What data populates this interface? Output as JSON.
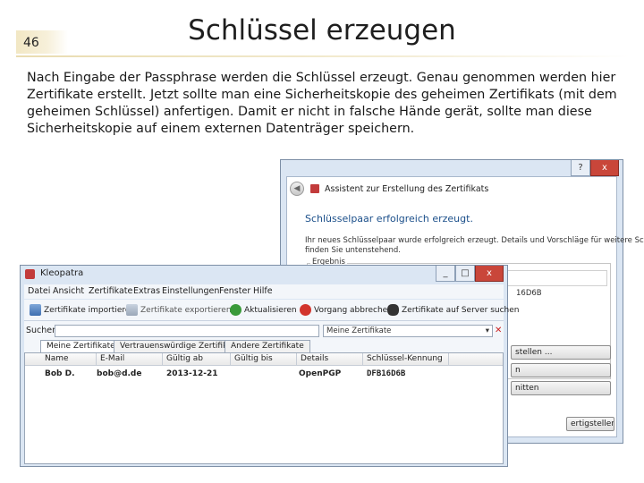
{
  "slide": {
    "page_number": "46",
    "title": "Schlüssel erzeugen",
    "body_lines": [
      "Nach Eingabe der Passphrase werden die Schlüssel erzeugt. Genau genommen werden hier",
      "Zertifikate erstellt. Jetzt sollte man eine Sicherheitskopie des geheimen Zertifikats (mit dem",
      "geheimen Schlüssel) anfertigen. Damit er nicht in falsche Hände gerät, sollte man diese",
      "Sicherheitskopie auf einem externen Datenträger speichern."
    ]
  },
  "wizard": {
    "title": "Assistent zur Erstellung des Zertifikats",
    "help_glyph": "?",
    "close_glyph": "x",
    "heading": "Schlüsselpaar erfolgreich erzeugt.",
    "desc_line1": "Ihr neues Schlüsselpaar wurde erfolgreich erzeugt. Details und Vorschläge für weitere Schritte",
    "desc_line2": "finden Sie untenstehend.",
    "group_label": "Ergebnis",
    "fingerprint_fragment": "16D6B",
    "btn1_fragment": "stellen ...",
    "btn2_fragment": "n",
    "btn3_fragment": "nitten",
    "finish_fragment": "ertigstellen"
  },
  "kleopatra": {
    "title": "Kleopatra",
    "window_controls": {
      "minimize": "_",
      "maximize": "□",
      "close": "x"
    },
    "menu": [
      "Datei",
      "Ansicht",
      "Zertifikate",
      "Extras",
      "Einstellungen",
      "Fenster",
      "Hilfe"
    ],
    "toolbar": {
      "import": "Zertifikate importieren",
      "export": "Zertifikate exportieren",
      "refresh": "Aktualisieren",
      "stop": "Vorgang abbrechen",
      "lookup": "Zertifikate auf Server suchen"
    },
    "search_label": "Suchen:",
    "filter_value": "Meine Zertifikate",
    "tabs": [
      "Meine Zertifikate",
      "Vertrauenswürdige Zertifikate",
      "Andere Zertifikate"
    ],
    "columns": [
      "Name",
      "E-Mail",
      "Gültig ab",
      "Gültig bis",
      "Details",
      "Schlüssel-Kennung"
    ],
    "rows": [
      {
        "name": "Bob D.",
        "email": "bob@d.de",
        "valid_from": "2013-12-21",
        "valid_until": "",
        "details": "OpenPGP",
        "key_id": "DFB16D6B"
      }
    ]
  },
  "colors": {
    "accent_rule": "#e9dcb0",
    "window_frame": "#dbe6f3",
    "close_button": "#c9463a",
    "heading_blue": "#1b4f8a"
  },
  "icons": [
    "gear-icon",
    "import-icon",
    "export-icon",
    "refresh-icon",
    "stop-icon",
    "binoculars-icon",
    "clear-search-icon",
    "dropdown-icon"
  ]
}
